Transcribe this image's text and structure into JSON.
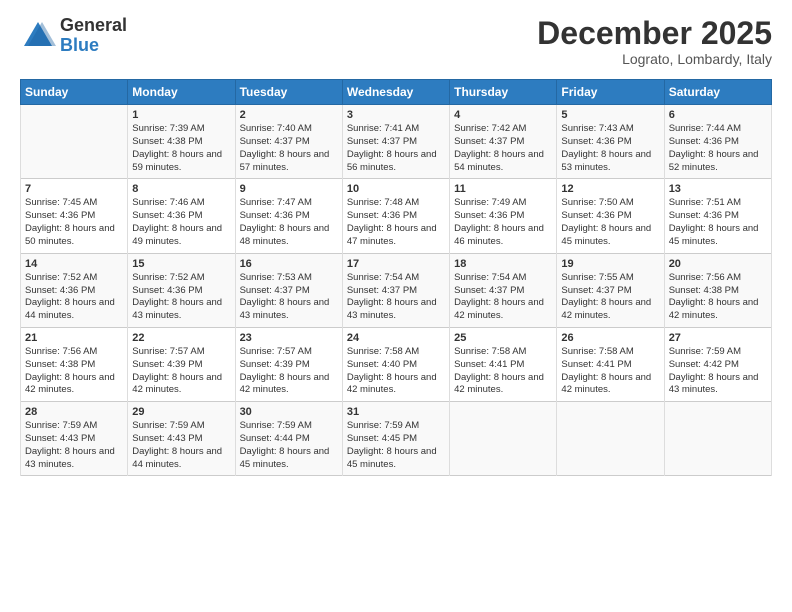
{
  "header": {
    "logo_general": "General",
    "logo_blue": "Blue",
    "month": "December 2025",
    "location": "Lograto, Lombardy, Italy"
  },
  "weekdays": [
    "Sunday",
    "Monday",
    "Tuesday",
    "Wednesday",
    "Thursday",
    "Friday",
    "Saturday"
  ],
  "rows": [
    [
      {
        "day": "",
        "sunrise": "",
        "sunset": "",
        "daylight": ""
      },
      {
        "day": "1",
        "sunrise": "Sunrise: 7:39 AM",
        "sunset": "Sunset: 4:38 PM",
        "daylight": "Daylight: 8 hours and 59 minutes."
      },
      {
        "day": "2",
        "sunrise": "Sunrise: 7:40 AM",
        "sunset": "Sunset: 4:37 PM",
        "daylight": "Daylight: 8 hours and 57 minutes."
      },
      {
        "day": "3",
        "sunrise": "Sunrise: 7:41 AM",
        "sunset": "Sunset: 4:37 PM",
        "daylight": "Daylight: 8 hours and 56 minutes."
      },
      {
        "day": "4",
        "sunrise": "Sunrise: 7:42 AM",
        "sunset": "Sunset: 4:37 PM",
        "daylight": "Daylight: 8 hours and 54 minutes."
      },
      {
        "day": "5",
        "sunrise": "Sunrise: 7:43 AM",
        "sunset": "Sunset: 4:36 PM",
        "daylight": "Daylight: 8 hours and 53 minutes."
      },
      {
        "day": "6",
        "sunrise": "Sunrise: 7:44 AM",
        "sunset": "Sunset: 4:36 PM",
        "daylight": "Daylight: 8 hours and 52 minutes."
      }
    ],
    [
      {
        "day": "7",
        "sunrise": "Sunrise: 7:45 AM",
        "sunset": "Sunset: 4:36 PM",
        "daylight": "Daylight: 8 hours and 50 minutes."
      },
      {
        "day": "8",
        "sunrise": "Sunrise: 7:46 AM",
        "sunset": "Sunset: 4:36 PM",
        "daylight": "Daylight: 8 hours and 49 minutes."
      },
      {
        "day": "9",
        "sunrise": "Sunrise: 7:47 AM",
        "sunset": "Sunset: 4:36 PM",
        "daylight": "Daylight: 8 hours and 48 minutes."
      },
      {
        "day": "10",
        "sunrise": "Sunrise: 7:48 AM",
        "sunset": "Sunset: 4:36 PM",
        "daylight": "Daylight: 8 hours and 47 minutes."
      },
      {
        "day": "11",
        "sunrise": "Sunrise: 7:49 AM",
        "sunset": "Sunset: 4:36 PM",
        "daylight": "Daylight: 8 hours and 46 minutes."
      },
      {
        "day": "12",
        "sunrise": "Sunrise: 7:50 AM",
        "sunset": "Sunset: 4:36 PM",
        "daylight": "Daylight: 8 hours and 45 minutes."
      },
      {
        "day": "13",
        "sunrise": "Sunrise: 7:51 AM",
        "sunset": "Sunset: 4:36 PM",
        "daylight": "Daylight: 8 hours and 45 minutes."
      }
    ],
    [
      {
        "day": "14",
        "sunrise": "Sunrise: 7:52 AM",
        "sunset": "Sunset: 4:36 PM",
        "daylight": "Daylight: 8 hours and 44 minutes."
      },
      {
        "day": "15",
        "sunrise": "Sunrise: 7:52 AM",
        "sunset": "Sunset: 4:36 PM",
        "daylight": "Daylight: 8 hours and 43 minutes."
      },
      {
        "day": "16",
        "sunrise": "Sunrise: 7:53 AM",
        "sunset": "Sunset: 4:37 PM",
        "daylight": "Daylight: 8 hours and 43 minutes."
      },
      {
        "day": "17",
        "sunrise": "Sunrise: 7:54 AM",
        "sunset": "Sunset: 4:37 PM",
        "daylight": "Daylight: 8 hours and 43 minutes."
      },
      {
        "day": "18",
        "sunrise": "Sunrise: 7:54 AM",
        "sunset": "Sunset: 4:37 PM",
        "daylight": "Daylight: 8 hours and 42 minutes."
      },
      {
        "day": "19",
        "sunrise": "Sunrise: 7:55 AM",
        "sunset": "Sunset: 4:37 PM",
        "daylight": "Daylight: 8 hours and 42 minutes."
      },
      {
        "day": "20",
        "sunrise": "Sunrise: 7:56 AM",
        "sunset": "Sunset: 4:38 PM",
        "daylight": "Daylight: 8 hours and 42 minutes."
      }
    ],
    [
      {
        "day": "21",
        "sunrise": "Sunrise: 7:56 AM",
        "sunset": "Sunset: 4:38 PM",
        "daylight": "Daylight: 8 hours and 42 minutes."
      },
      {
        "day": "22",
        "sunrise": "Sunrise: 7:57 AM",
        "sunset": "Sunset: 4:39 PM",
        "daylight": "Daylight: 8 hours and 42 minutes."
      },
      {
        "day": "23",
        "sunrise": "Sunrise: 7:57 AM",
        "sunset": "Sunset: 4:39 PM",
        "daylight": "Daylight: 8 hours and 42 minutes."
      },
      {
        "day": "24",
        "sunrise": "Sunrise: 7:58 AM",
        "sunset": "Sunset: 4:40 PM",
        "daylight": "Daylight: 8 hours and 42 minutes."
      },
      {
        "day": "25",
        "sunrise": "Sunrise: 7:58 AM",
        "sunset": "Sunset: 4:41 PM",
        "daylight": "Daylight: 8 hours and 42 minutes."
      },
      {
        "day": "26",
        "sunrise": "Sunrise: 7:58 AM",
        "sunset": "Sunset: 4:41 PM",
        "daylight": "Daylight: 8 hours and 42 minutes."
      },
      {
        "day": "27",
        "sunrise": "Sunrise: 7:59 AM",
        "sunset": "Sunset: 4:42 PM",
        "daylight": "Daylight: 8 hours and 43 minutes."
      }
    ],
    [
      {
        "day": "28",
        "sunrise": "Sunrise: 7:59 AM",
        "sunset": "Sunset: 4:43 PM",
        "daylight": "Daylight: 8 hours and 43 minutes."
      },
      {
        "day": "29",
        "sunrise": "Sunrise: 7:59 AM",
        "sunset": "Sunset: 4:43 PM",
        "daylight": "Daylight: 8 hours and 44 minutes."
      },
      {
        "day": "30",
        "sunrise": "Sunrise: 7:59 AM",
        "sunset": "Sunset: 4:44 PM",
        "daylight": "Daylight: 8 hours and 45 minutes."
      },
      {
        "day": "31",
        "sunrise": "Sunrise: 7:59 AM",
        "sunset": "Sunset: 4:45 PM",
        "daylight": "Daylight: 8 hours and 45 minutes."
      },
      {
        "day": "",
        "sunrise": "",
        "sunset": "",
        "daylight": ""
      },
      {
        "day": "",
        "sunrise": "",
        "sunset": "",
        "daylight": ""
      },
      {
        "day": "",
        "sunrise": "",
        "sunset": "",
        "daylight": ""
      }
    ]
  ]
}
